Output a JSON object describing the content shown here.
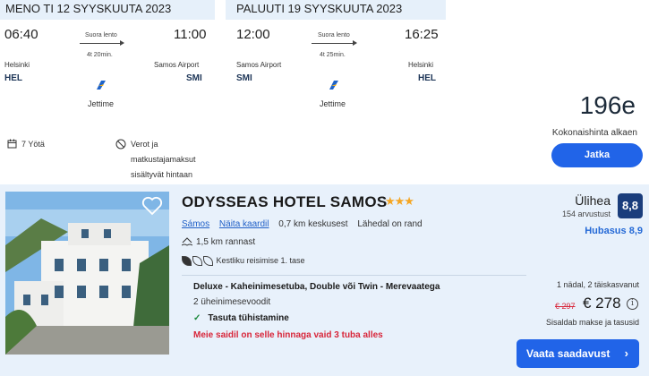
{
  "flights": {
    "outbound": {
      "header": "MENO TI 12 SYYSKUUTA 2023",
      "dep_time": "06:40",
      "arr_time": "11:00",
      "route_type": "Suora lento",
      "duration": "4t 20min.",
      "from_city": "Helsinki",
      "from_code": "HEL",
      "to_city": "Samos Airport",
      "to_code": "SMI",
      "airline": "Jettime"
    },
    "return": {
      "header": "PALUUTI 19 SYYSKUUTA 2023",
      "dep_time": "12:00",
      "arr_time": "16:25",
      "route_type": "Suora lento",
      "duration": "4t 25min.",
      "from_city": "Samos Airport",
      "from_code": "SMI",
      "to_city": "Helsinki",
      "to_code": "HEL",
      "airline": "Jettime"
    },
    "nights": "7 Yötä",
    "taxes_line1": "Verot ja",
    "taxes_line2": "matkustajamaksut",
    "taxes_line3": "sisältyvät hintaan"
  },
  "package": {
    "price": "196e",
    "caption": "Kokonaishinta alkaen",
    "continue_label": "Jatka"
  },
  "hotel": {
    "name": "ODYSSEAS HOTEL SAMOS",
    "stars": "★★★",
    "location": "Sámos",
    "map_link": "Näita kaardil",
    "distance_center": "0,7 km keskusest",
    "near_beach": "Lähedal on rand",
    "beach_distance": "1,5 km rannast",
    "sustainability": "Kestliku reisimise 1. tase",
    "room_type": "Deluxe - Kaheinimesetuba, Double või Twin - Merevaatega",
    "beds": "2 üheinimesevoodit",
    "cancellation": "Tasuta tühistamine",
    "scarcity": "Meie saidil on selle hinnaga vaid 3 tuba alles",
    "rating_word": "Ülihea",
    "reviews": "154 arvustust",
    "score": "8,8",
    "cleanliness": "Hubasus 8,9",
    "stay_info": "1 nädal, 2 täiskasvanut",
    "old_price": "€ 297",
    "new_price": "€ 278",
    "info_icon": "i",
    "tax_note": "Sisaldab makse ja tasusid",
    "cta_label": "Vaata saadavust",
    "cta_chevron": "›"
  },
  "colors": {
    "accent": "#2164e8",
    "header_bg": "#e6f0fa",
    "card_bg": "#e8f1fb",
    "badge": "#1a3d7c",
    "alert": "#d8263a",
    "success": "#1b8a3c",
    "stars": "#f5a623"
  }
}
